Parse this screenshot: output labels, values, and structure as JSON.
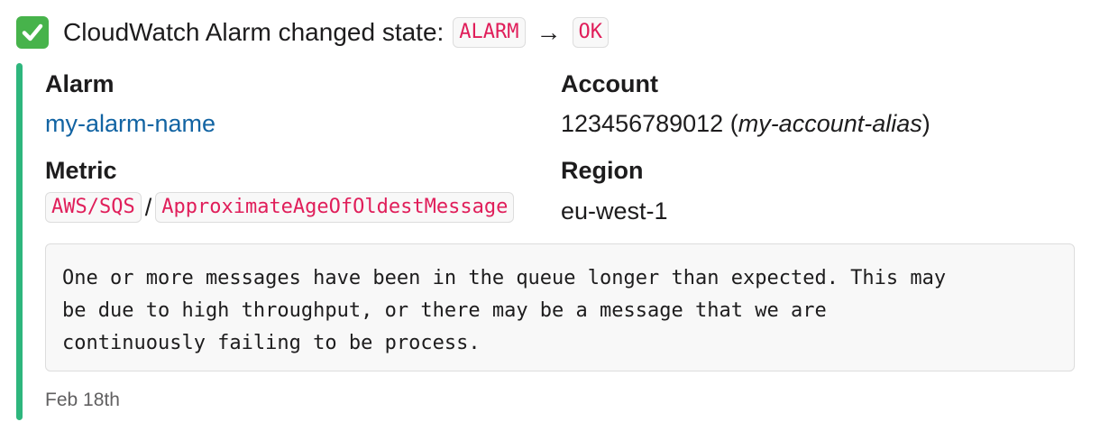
{
  "header": {
    "icon": "check-mark-button-icon",
    "title": "CloudWatch Alarm changed state:",
    "old_state": "ALARM",
    "arrow": "→",
    "new_state": "OK"
  },
  "colors": {
    "accent_bar": "#2eb67d",
    "link": "#1264a3",
    "code_text": "#e01e5a"
  },
  "fields": {
    "alarm": {
      "title": "Alarm",
      "value": "my-alarm-name"
    },
    "account": {
      "title": "Account",
      "id": "123456789012",
      "alias": "my-account-alias"
    },
    "metric": {
      "title": "Metric",
      "namespace": "AWS/SQS",
      "separator": "/",
      "name": "ApproximateAgeOfOldestMessage"
    },
    "region": {
      "title": "Region",
      "value": "eu-west-1"
    }
  },
  "description": {
    "lines": [
      "One or more messages have been in the queue longer than expected. This may",
      "be due to high throughput, or there may be a message that we are",
      "continuously failing to be process."
    ]
  },
  "footer": {
    "timestamp": "Feb 18th"
  }
}
